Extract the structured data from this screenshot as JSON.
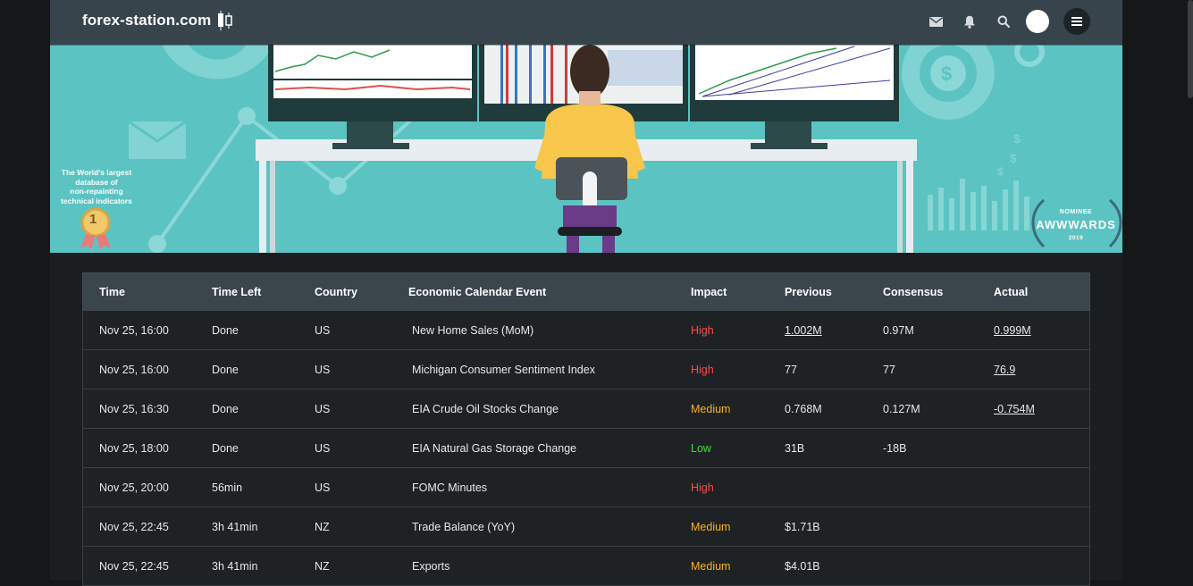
{
  "header": {
    "logo_text": "forex-station.com",
    "icons": [
      "envelope-icon",
      "bell-icon",
      "search-icon",
      "avatar",
      "menu-icon"
    ]
  },
  "hero": {
    "tagline_lines": [
      "The World's largest",
      "database of",
      "non-repainting",
      "technical indicators"
    ],
    "medal_number": "1",
    "award": {
      "nominee": "NOMINEE",
      "name": "AWWWARDS",
      "year": "2019"
    }
  },
  "table": {
    "headers": [
      "Time",
      "Time Left",
      "Country",
      "Economic Calendar Event",
      "Impact",
      "Previous",
      "Consensus",
      "Actual"
    ],
    "rows": [
      {
        "time": "Nov 25, 16:00",
        "left": "Done",
        "country": "US",
        "event": "New Home Sales (MoM)",
        "impact": "High",
        "previous": "1.002M",
        "consensus": "0.97M",
        "actual": "0.999M"
      },
      {
        "time": "Nov 25, 16:00",
        "left": "Done",
        "country": "US",
        "event": "Michigan Consumer Sentiment Index",
        "impact": "High",
        "previous": "77",
        "consensus": "77",
        "actual": "76.9"
      },
      {
        "time": "Nov 25, 16:30",
        "left": "Done",
        "country": "US",
        "event": "EIA Crude Oil Stocks Change",
        "impact": "Medium",
        "previous": "0.768M",
        "consensus": "0.127M",
        "actual": "-0.754M"
      },
      {
        "time": "Nov 25, 18:00",
        "left": "Done",
        "country": "US",
        "event": "EIA Natural Gas Storage Change",
        "impact": "Low",
        "previous": "31B",
        "consensus": "-18B",
        "actual": ""
      },
      {
        "time": "Nov 25, 20:00",
        "left": "56min",
        "country": "US",
        "event": "FOMC Minutes",
        "impact": "High",
        "previous": "",
        "consensus": "",
        "actual": ""
      },
      {
        "time": "Nov 25, 22:45",
        "left": "3h 41min",
        "country": "NZ",
        "event": "Trade Balance (YoY)",
        "impact": "Medium",
        "previous": "$1.71B",
        "consensus": "",
        "actual": ""
      },
      {
        "time": "Nov 25, 22:45",
        "left": "3h 41min",
        "country": "NZ",
        "event": "Exports",
        "impact": "Medium",
        "previous": "$4.01B",
        "consensus": "",
        "actual": ""
      }
    ]
  },
  "colors": {
    "nav_bg": "#37444c",
    "hero_bg": "#5cc3c3",
    "impact_high": "#ff4a4a",
    "impact_medium": "#f5b423",
    "impact_low": "#3fe03f"
  }
}
